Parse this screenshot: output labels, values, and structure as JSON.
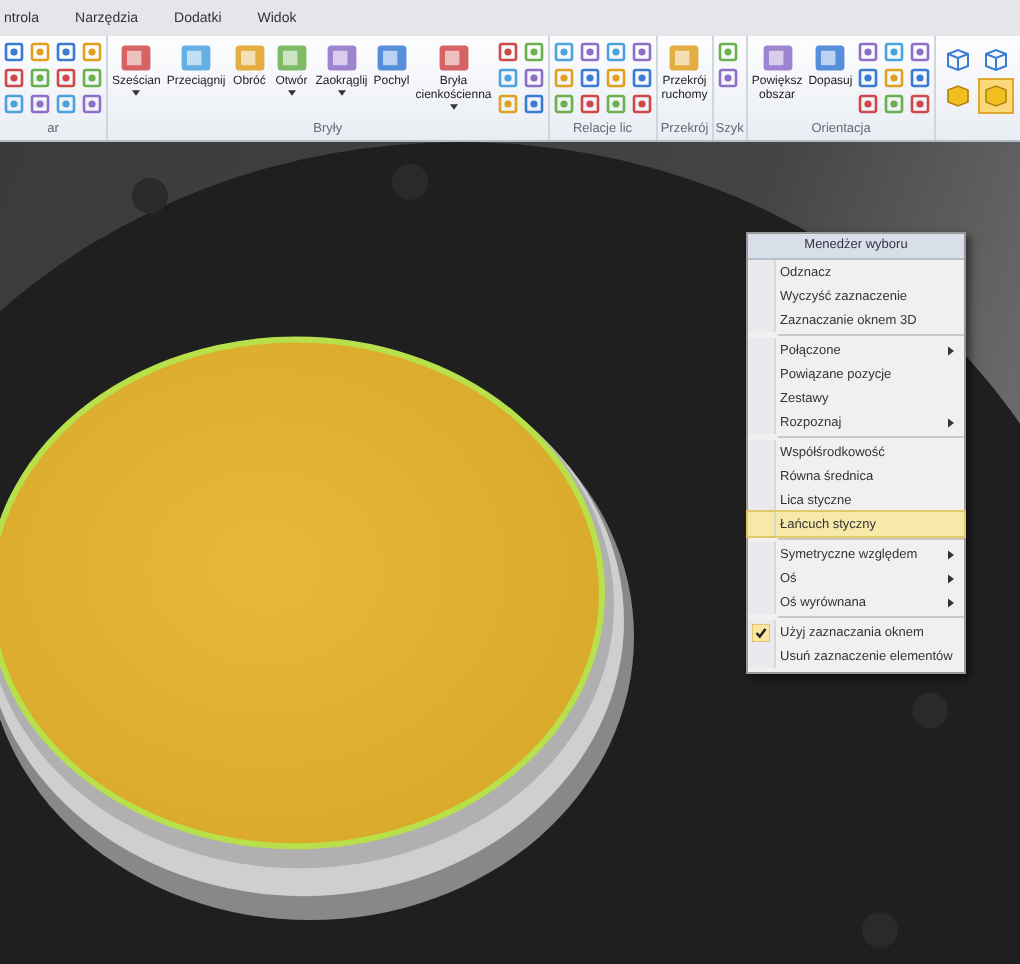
{
  "ribbon_tabs": [
    {
      "label": "ntrola",
      "selected": false
    },
    {
      "label": "Narzędzia",
      "selected": false
    },
    {
      "label": "Dodatki",
      "selected": false
    },
    {
      "label": "Widok",
      "selected": false
    }
  ],
  "ribbon_groups": [
    {
      "label": "ar"
    },
    {
      "label": "Bryły",
      "buttons": [
        {
          "label": "Sześcian",
          "dropdown": true
        },
        {
          "label": "Przeciągnij",
          "dropdown": false
        },
        {
          "label": "Obróć",
          "dropdown": false
        },
        {
          "label": "Otwór",
          "dropdown": true
        },
        {
          "label": "Zaokrąglij",
          "dropdown": true
        },
        {
          "label": "Pochyl",
          "dropdown": false
        },
        {
          "label": "Bryła cienkościenna",
          "dropdown": true
        }
      ]
    },
    {
      "label": "Relacje lic"
    },
    {
      "label": "Przekrój",
      "buttons": [
        {
          "label": "Przekrój ruchomy",
          "dropdown": false
        }
      ]
    },
    {
      "label": "Szyk"
    },
    {
      "label": "Orientacja",
      "buttons": [
        {
          "label": "Powiększ obszar",
          "dropdown": false
        },
        {
          "label": "Dopasuj",
          "dropdown": false
        }
      ]
    },
    {
      "kind": "views"
    }
  ],
  "context_menu": {
    "title": "Menedżer wyboru",
    "sections": [
      [
        {
          "label": "Odznacz",
          "submenu": false,
          "selected": false,
          "checked": false
        },
        {
          "label": "Wyczyść zaznaczenie",
          "submenu": false,
          "selected": false,
          "checked": false
        },
        {
          "label": "Zaznaczanie oknem 3D",
          "submenu": false,
          "selected": false,
          "checked": false
        }
      ],
      [
        {
          "label": "Połączone",
          "submenu": true,
          "selected": false,
          "checked": false
        },
        {
          "label": "Powiązane pozycje",
          "submenu": false,
          "selected": false,
          "checked": false
        },
        {
          "label": "Zestawy",
          "submenu": false,
          "selected": false,
          "checked": false
        },
        {
          "label": "Rozpoznaj",
          "submenu": true,
          "selected": false,
          "checked": false
        }
      ],
      [
        {
          "label": "Współśrodkowość",
          "submenu": false,
          "selected": false,
          "checked": false
        },
        {
          "label": "Równa średnica",
          "submenu": false,
          "selected": false,
          "checked": false
        },
        {
          "label": "Lica styczne",
          "submenu": false,
          "selected": false,
          "checked": false
        },
        {
          "label": "Łańcuch styczny",
          "submenu": false,
          "selected": true,
          "checked": false
        }
      ],
      [
        {
          "label": "Symetryczne względem",
          "submenu": true,
          "selected": false,
          "checked": false
        },
        {
          "label": "Oś",
          "submenu": true,
          "selected": false,
          "checked": false
        },
        {
          "label": "Oś wyrównana",
          "submenu": true,
          "selected": false,
          "checked": false
        }
      ],
      [
        {
          "label": "Użyj zaznaczania oknem",
          "submenu": false,
          "selected": false,
          "checked": true
        },
        {
          "label": "Usuń zaznaczenie elementów",
          "submenu": false,
          "selected": false,
          "checked": false
        }
      ]
    ]
  }
}
